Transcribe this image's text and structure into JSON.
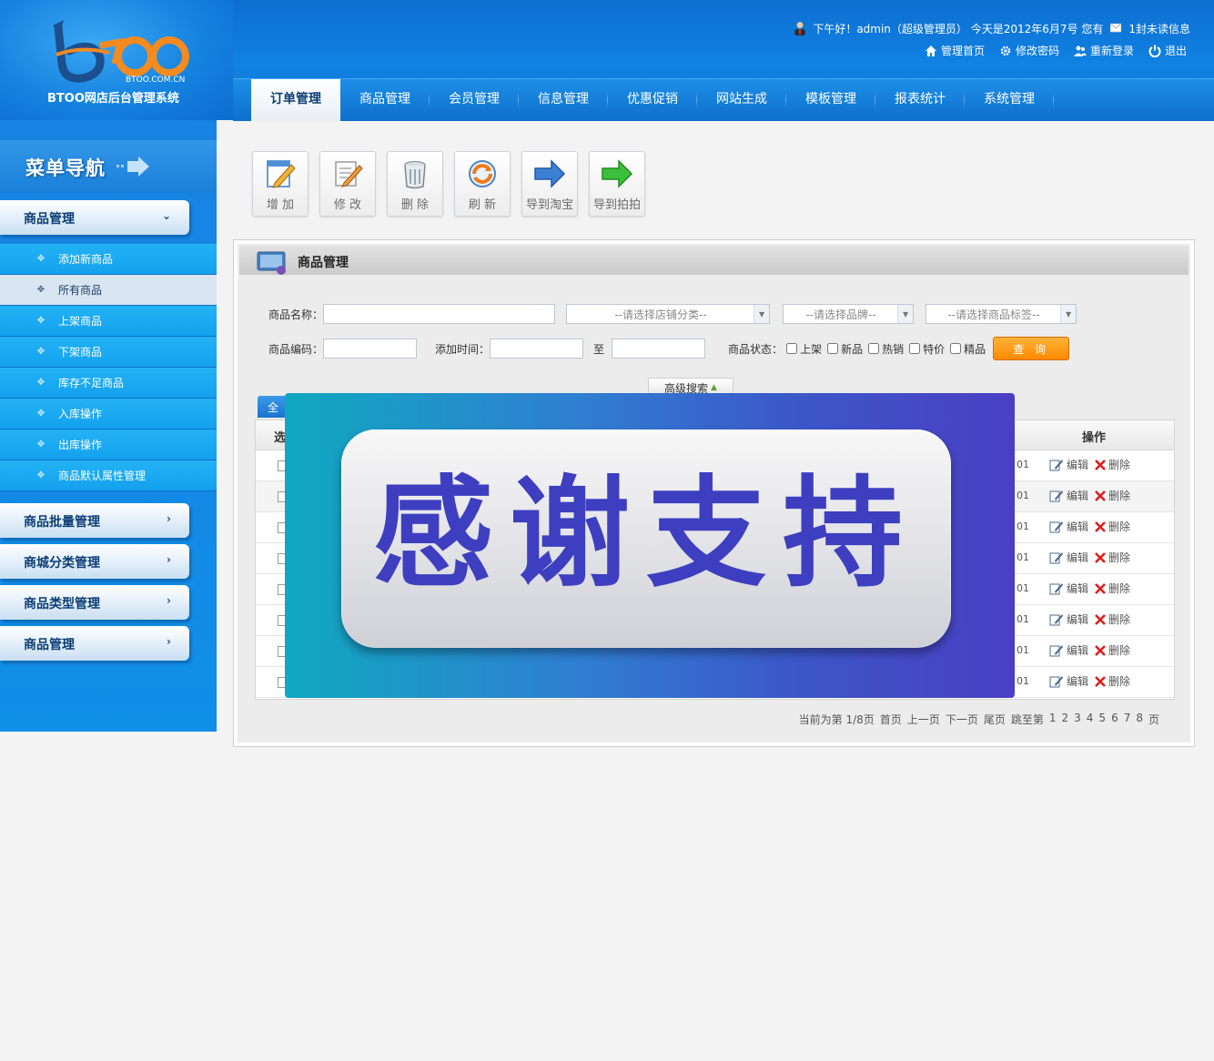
{
  "colors": {
    "brand_blue": "#1182e3",
    "nav_active_text": "#0b3e73",
    "query_orange": "#ff8a00",
    "overlay_text": "#3d3fc0"
  },
  "header": {
    "logo_text": "BTOO",
    "logo_domain": "BTOO.COM.CN",
    "system_name": "BTOO网店后台管理系统",
    "greeting": "下午好！admin（超级管理员） 今天是2012年6月7号 您有",
    "unread": "1封未读信息",
    "links": [
      {
        "label": "管理首页",
        "icon": "home-icon"
      },
      {
        "label": "修改密码",
        "icon": "gear-icon"
      },
      {
        "label": "重新登录",
        "icon": "users-icon"
      },
      {
        "label": "退出",
        "icon": "power-icon"
      }
    ]
  },
  "nav": {
    "tabs": [
      {
        "label": "订单管理",
        "active": true
      },
      {
        "label": "商品管理",
        "active": false
      },
      {
        "label": "会员管理",
        "active": false
      },
      {
        "label": "信息管理",
        "active": false
      },
      {
        "label": "优惠促销",
        "active": false
      },
      {
        "label": "网站生成",
        "active": false
      },
      {
        "label": "模板管理",
        "active": false
      },
      {
        "label": "报表统计",
        "active": false
      },
      {
        "label": "系统管理",
        "active": false
      }
    ]
  },
  "sidebar": {
    "title": "菜单导航",
    "groups": [
      {
        "label": "商品管理",
        "chevron": "⌄"
      },
      {
        "label": "商品批量管理",
        "chevron": "›"
      },
      {
        "label": "商城分类管理",
        "chevron": "›"
      },
      {
        "label": "商品类型管理",
        "chevron": "›"
      },
      {
        "label": "商品管理",
        "chevron": "›"
      }
    ],
    "items": [
      {
        "label": "添加新商品",
        "active": false
      },
      {
        "label": "所有商品",
        "active": true
      },
      {
        "label": "上架商品",
        "active": false
      },
      {
        "label": "下架商品",
        "active": false
      },
      {
        "label": "库存不足商品",
        "active": false
      },
      {
        "label": "入库操作",
        "active": false
      },
      {
        "label": "出库操作",
        "active": false
      },
      {
        "label": "商品默认属性管理",
        "active": false
      }
    ]
  },
  "toolbar": {
    "buttons": [
      {
        "label": "增 加",
        "icon": "add-icon"
      },
      {
        "label": "修 改",
        "icon": "edit-icon"
      },
      {
        "label": "删 除",
        "icon": "trash-icon"
      },
      {
        "label": "刷 新",
        "icon": "refresh-icon"
      },
      {
        "label": "导到淘宝",
        "icon": "arrow-right-blue-icon"
      },
      {
        "label": "导到拍拍",
        "icon": "arrow-right-green-icon"
      }
    ]
  },
  "panel": {
    "title": "商品管理",
    "search": {
      "name_label": "商品名称：",
      "name_value": "",
      "category_placeholder": "--请选择店铺分类--",
      "brand_placeholder": "--请选择品牌--",
      "tag_placeholder": "--请选择商品标签--",
      "code_label": "商品编码：",
      "code_value": "",
      "time_label": "添加时间：",
      "time_from": "",
      "time_to_label": "至",
      "time_to": "",
      "status_label": "商品状态：",
      "statuses": [
        "上架",
        "新品",
        "热销",
        "特价",
        "精品"
      ],
      "query_label": "查 询",
      "advanced_label": "高级搜索"
    },
    "select_all_label": "全",
    "table": {
      "col_select": "选",
      "col_ops": "操作",
      "row_code_suffix": "01",
      "edit_label": "编辑",
      "delete_label": "删除",
      "row_count": 8
    },
    "pager": {
      "current": "当前为第 1/8页",
      "first": "首页",
      "prev": "上一页",
      "next": "下一页",
      "last": "尾页",
      "jump": "跳至第",
      "pages": [
        "1",
        "2",
        "3",
        "4",
        "5",
        "6",
        "7",
        "8"
      ],
      "page_suffix": "页"
    }
  },
  "overlay": {
    "text": "感谢支持"
  }
}
